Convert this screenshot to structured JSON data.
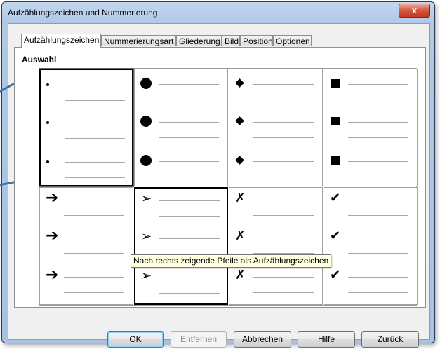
{
  "window": {
    "title": "Aufzählungszeichen und Nummerierung",
    "close_glyph": "x"
  },
  "tabs": [
    {
      "label": "Aufzählungszeichen",
      "active": true
    },
    {
      "label": "Nummerierungsart",
      "active": false
    },
    {
      "label": "Gliederung",
      "active": false
    },
    {
      "label": "Bild",
      "active": false
    },
    {
      "label": "Position",
      "active": false
    },
    {
      "label": "Optionen",
      "active": false
    }
  ],
  "section": {
    "label": "Auswahl"
  },
  "bullet_styles": [
    {
      "name": "small-dot",
      "icon": "small-dot-icon",
      "selected": true
    },
    {
      "name": "large-dot",
      "icon": "large-dot-icon"
    },
    {
      "name": "diamond",
      "icon": "diamond-icon"
    },
    {
      "name": "square",
      "icon": "square-icon"
    },
    {
      "name": "arrow-right",
      "icon": "arrow-right-icon",
      "glyph": "➔"
    },
    {
      "name": "arrowhead",
      "icon": "arrowhead-icon",
      "glyph": "➢",
      "hover": true
    },
    {
      "name": "cross",
      "icon": "cross-icon",
      "glyph": "✗"
    },
    {
      "name": "checkmark",
      "icon": "checkmark-icon",
      "glyph": "✔"
    }
  ],
  "tooltip": {
    "text": "Nach rechts zeigende Pfeile als Aufzählungszeichen"
  },
  "buttons": {
    "ok": "OK",
    "remove_prefix": "E",
    "remove_rest": "ntfernen",
    "cancel": "Abbrechen",
    "help_prefix": "H",
    "help_rest": "ilfe",
    "back_prefix": "Z",
    "back_rest": "urück"
  }
}
